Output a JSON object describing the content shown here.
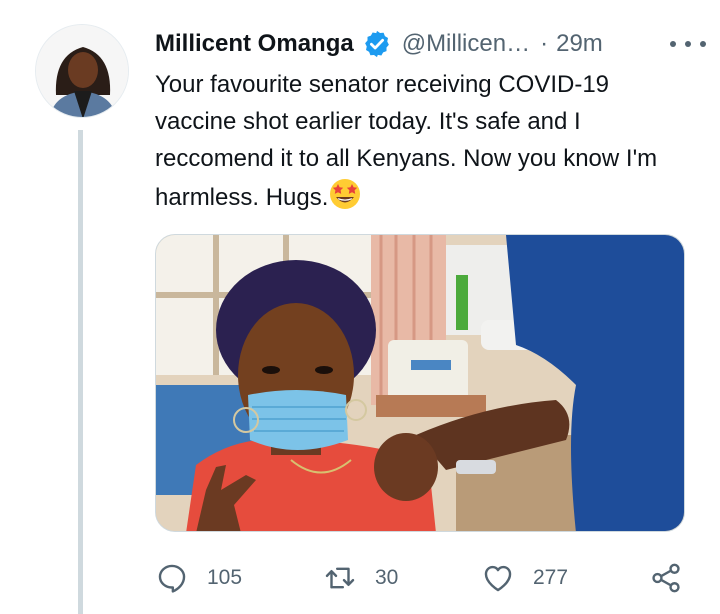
{
  "author": {
    "display_name": "Millicent Omanga",
    "handle": "@Millicen…",
    "time": "29m",
    "verified_icon": "verified-badge-icon"
  },
  "tweet": {
    "line1": "Your favourite senator receiving COVID-19",
    "line2": "vaccine shot earlier today. It's safe and I",
    "line3": "reccomend it to all Kenyans. Now you know I'm",
    "line4": "harmless. Hugs.",
    "emoji": "star-struck-emoji"
  },
  "actions": {
    "replies": "105",
    "retweets": "30",
    "likes": "277"
  },
  "colors": {
    "verified": "#1d9bf0",
    "secondary_text": "#536471",
    "thread_line": "#cfd9de"
  }
}
